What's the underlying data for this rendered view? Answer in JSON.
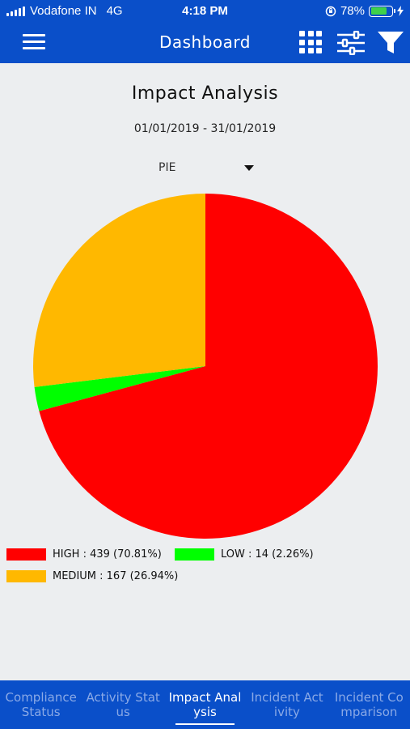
{
  "status_bar": {
    "carrier": "Vodafone IN",
    "network": "4G",
    "time": "4:18 PM",
    "battery_percent": "78%",
    "battery_level": 0.78
  },
  "header": {
    "title": "Dashboard",
    "icons": [
      "menu-icon",
      "grid-icon",
      "sliders-icon",
      "filter-icon"
    ]
  },
  "chart_header": {
    "title": "Impact Analysis",
    "date_range": "01/01/2019 - 31/01/2019",
    "chart_type_selected": "PIE"
  },
  "chart_data": {
    "type": "pie",
    "slices": [
      {
        "name": "HIGH",
        "value": 439,
        "percent": 70.81,
        "color": "#ff0000"
      },
      {
        "name": "LOW",
        "value": 14,
        "percent": 2.26,
        "color": "#00ff00"
      },
      {
        "name": "MEDIUM",
        "value": 167,
        "percent": 26.94,
        "color": "#ffb800"
      }
    ],
    "legend": [
      {
        "label": "HIGH : 439 (70.81%)",
        "color": "#ff0000"
      },
      {
        "label": "LOW : 14 (2.26%)",
        "color": "#00ff00"
      },
      {
        "label": "MEDIUM : 167 (26.94%)",
        "color": "#ffb800"
      }
    ]
  },
  "bottom_nav": {
    "tabs": [
      {
        "label": "Compliance Status",
        "active": false
      },
      {
        "label": "Activity Status",
        "active": false
      },
      {
        "label": "Impact Analysis",
        "active": true
      },
      {
        "label": "Incident Activity",
        "active": false
      },
      {
        "label": "Incident Comparison",
        "active": false
      }
    ]
  },
  "colors": {
    "brand": "#0a4fc9",
    "background": "#eceef0"
  }
}
